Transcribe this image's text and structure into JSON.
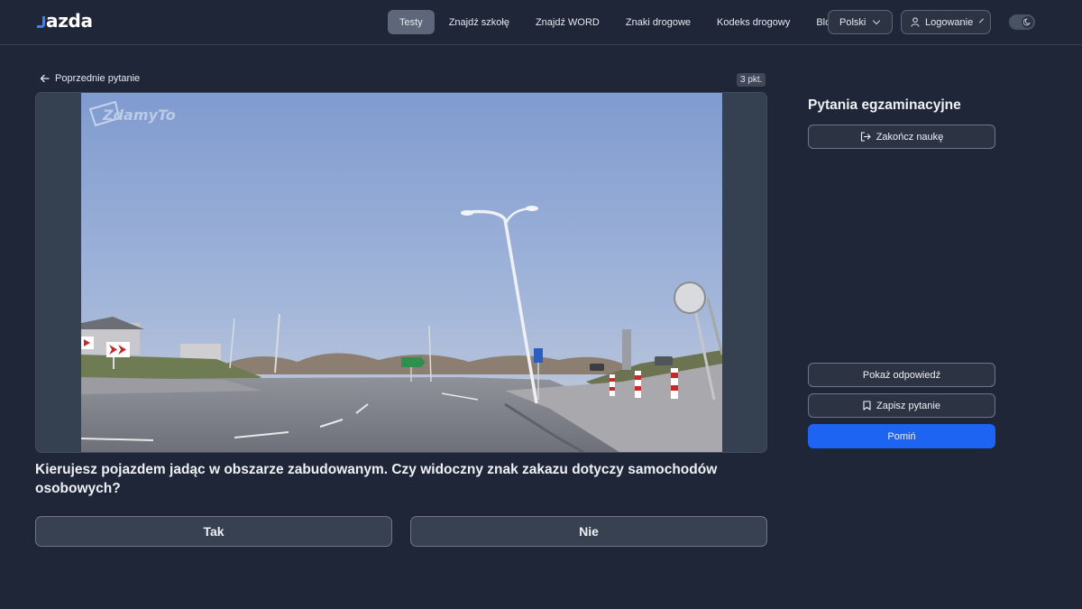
{
  "header": {
    "logo": "Jazda",
    "nav": [
      "Testy",
      "Znajdź szkołę",
      "Znajdź WORD",
      "Znaki drogowe",
      "Kodeks drogowy",
      "Blog"
    ],
    "active_nav": "Testy",
    "language": "Polski",
    "login": "Logowanie"
  },
  "quiz": {
    "back_label": "Poprzednie pytanie",
    "points": "3 pkt.",
    "watermark": "ZdamyTo",
    "question": "Kierujesz pojazdem jadąc w obszarze zabudowanym. Czy widoczny znak zakazu dotyczy samochodów osobowych?",
    "answers": [
      "Tak",
      "Nie"
    ]
  },
  "sidebar": {
    "title": "Pytania egzaminacyjne",
    "end_learning": "Zakończ naukę",
    "show_answer": "Pokaż odpowiedź",
    "save_question": "Zapisz pytanie",
    "skip": "Pomiń"
  },
  "colors": {
    "background": "#1f2637",
    "accent": "#1d64f2",
    "logo_accent": "#3b82f6"
  }
}
